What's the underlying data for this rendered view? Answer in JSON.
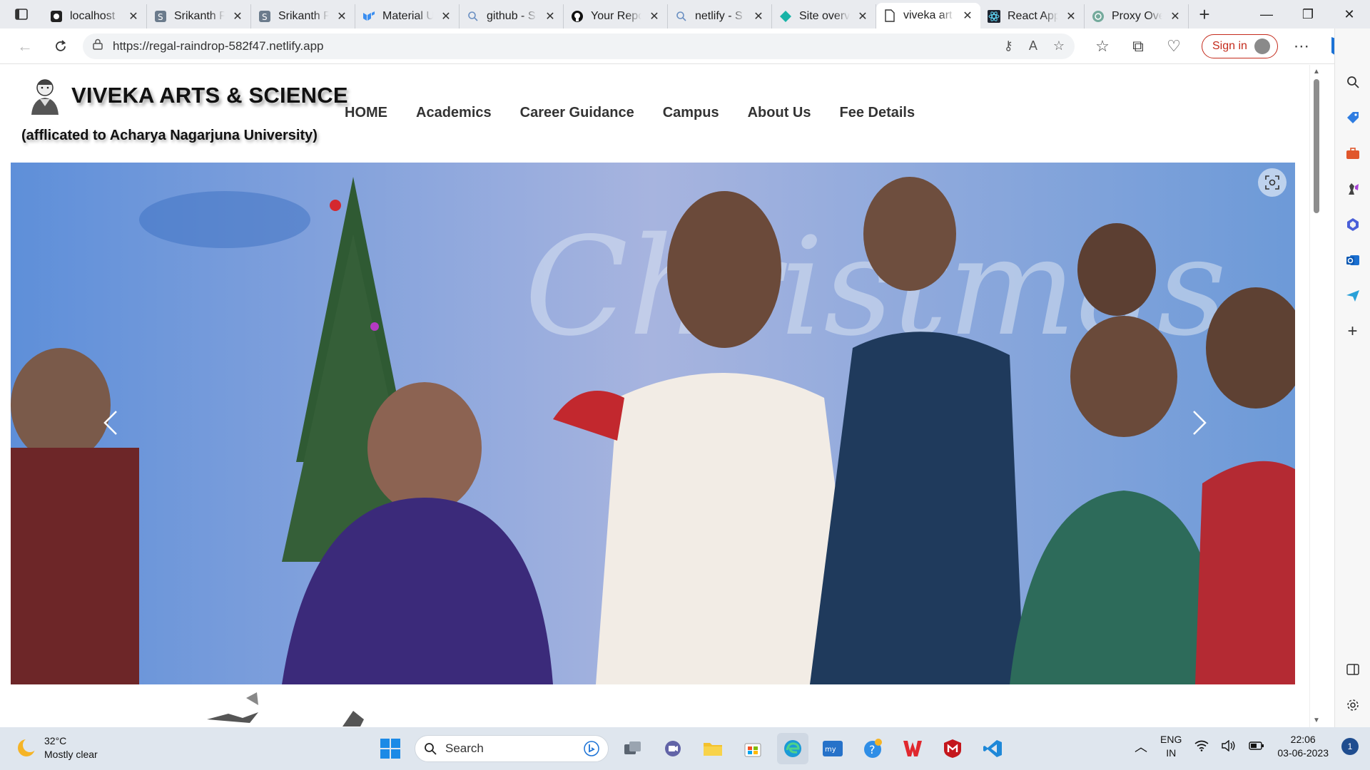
{
  "browser": {
    "tabs": [
      {
        "title": "localhost",
        "icon": "localhost-icon"
      },
      {
        "title": "Srikanth P",
        "icon": "s-site-icon"
      },
      {
        "title": "Srikanth P",
        "icon": "s-site-icon"
      },
      {
        "title": "Material U",
        "icon": "material-ui-icon"
      },
      {
        "title": "github - S",
        "icon": "search-icon"
      },
      {
        "title": "Your Repo",
        "icon": "github-icon"
      },
      {
        "title": "netlify - S",
        "icon": "search-icon"
      },
      {
        "title": "Site overv",
        "icon": "netlify-icon"
      },
      {
        "title": "viveka art",
        "icon": "page-icon",
        "active": true
      },
      {
        "title": "React App",
        "icon": "react-icon"
      },
      {
        "title": "Proxy Ove",
        "icon": "chatgpt-icon"
      }
    ],
    "url": "https://regal-raindrop-582f47.netlify.app",
    "sign_in": "Sign in"
  },
  "site": {
    "title": "VIVEKA ARTS & SCIENCE",
    "subtitle": "(afflicated to Acharya Nagarjuna University)",
    "nav": [
      "HOME",
      "Academics",
      "Career Guidance",
      "Campus",
      "About Us",
      "Fee Details"
    ],
    "carousel": {
      "slide_text": "Christmas"
    }
  },
  "taskbar": {
    "weather_temp": "32°C",
    "weather_desc": "Mostly clear",
    "search_placeholder": "Search",
    "lang_1": "ENG",
    "lang_2": "IN",
    "time": "22:06",
    "date": "03-06-2023",
    "notifications": "1"
  },
  "colors": {
    "accent": "#c42b1c",
    "taskbar": "#dfe6ee",
    "tabstrip": "#e9ebef"
  }
}
